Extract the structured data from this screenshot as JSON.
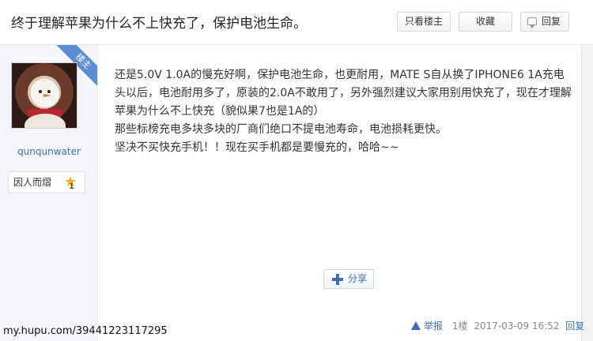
{
  "thread": {
    "title": "终于理解苹果为什么不上快充了，保护电池生命。"
  },
  "toolbar": {
    "only_op_label": "只看楼主",
    "favorite_label": "收藏",
    "reply_label": "回复"
  },
  "author": {
    "badge": "楼主",
    "username": "qunqunwater",
    "rank_title": "因人而熠",
    "rank_level": "1"
  },
  "post": {
    "paragraphs": [
      "还是5.0V 1.0A的慢充好啊，保护电池生命，也更耐用，MATE S自从换了IPHONE6 1A充电头以后，电池耐用多了，原装的2.0A不敢用了，另外强烈建议大家用别用快充了，现在才理解苹果为什么不上快充（貌似果7也是1A的）",
      "那些标榜充电多块多块的厂商们绝口不提电池寿命，电池损耗更快。",
      "坚决不买快充手机！！现在买手机都是要慢充的，哈哈~~"
    ],
    "share_label": "分享",
    "report_label": "举报",
    "floor": "1楼",
    "timestamp": "2017-03-09 16:52",
    "reply_label": "回复"
  },
  "watermark": "my.hupu.com/39441223117295",
  "icons": {
    "reply": "speech-bubble-icon",
    "share": "plus-icon",
    "report": "warning-icon",
    "rank": "star-icon"
  },
  "colors": {
    "link": "#3e6fb5",
    "badge": "#5b8dd6",
    "star": "#f2b01e"
  }
}
